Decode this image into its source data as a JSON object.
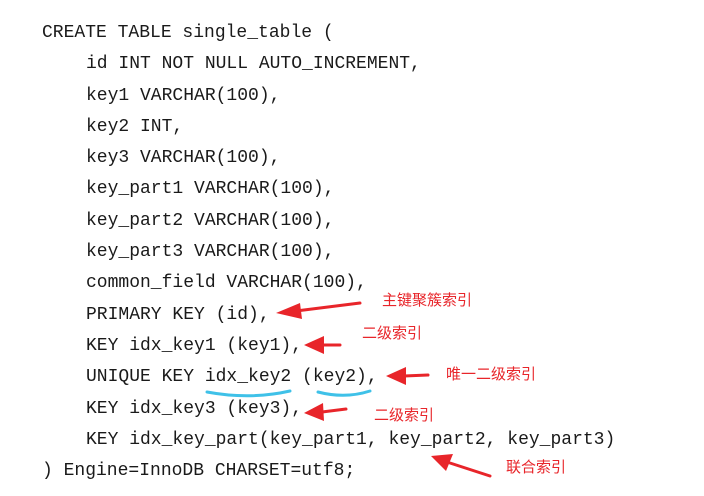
{
  "code": {
    "lines": [
      "CREATE TABLE single_table (",
      "id INT NOT NULL AUTO_INCREMENT,",
      "key1 VARCHAR(100),",
      "key2 INT,",
      "key3 VARCHAR(100),",
      "key_part1 VARCHAR(100),",
      "key_part2 VARCHAR(100),",
      "key_part3 VARCHAR(100),",
      "common_field VARCHAR(100),",
      "PRIMARY KEY (id),",
      "KEY idx_key1 (key1),",
      "UNIQUE KEY idx_key2 (key2),",
      "KEY idx_key3 (key3),",
      "KEY idx_key_part(key_part1, key_part2, key_part3)",
      ") Engine=InnoDB CHARSET=utf8;"
    ]
  },
  "annotations": {
    "primary": "主键聚簇索引",
    "secondary1": "二级索引",
    "unique_secondary": "唯一二级索引",
    "secondary3": "二级索引",
    "composite": "联合索引"
  },
  "colors": {
    "arrow": "#e8252a",
    "underline": "#3fc1e8",
    "code_text": "#1a1a1a"
  }
}
